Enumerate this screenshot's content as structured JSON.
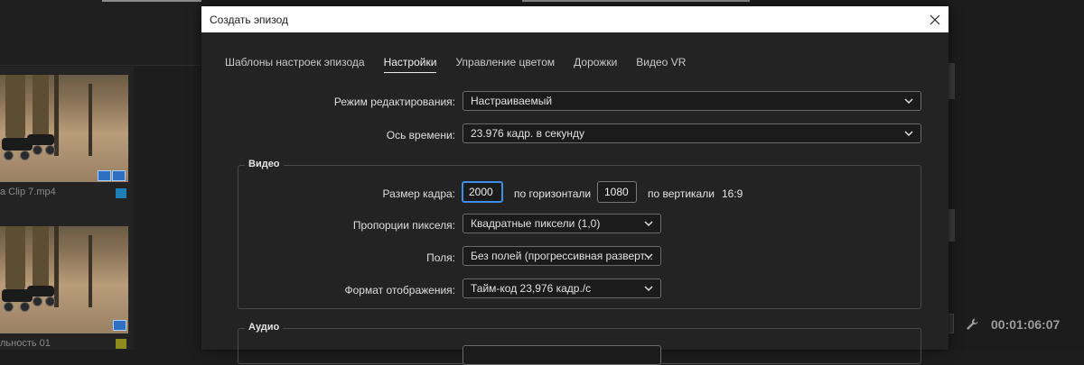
{
  "background": {
    "clips": [
      {
        "caption": "a Clip 7.mp4",
        "badge_color": "#1e7fb4"
      },
      {
        "caption": "льность 01",
        "badge_color": "#8d8b1e"
      }
    ],
    "timecode": "00:01:06:07"
  },
  "dialog": {
    "title": "Создать эпизод",
    "tabs": [
      {
        "label": "Шаблоны настроек эпизода",
        "active": false
      },
      {
        "label": "Настройки",
        "active": true
      },
      {
        "label": "Управление цветом",
        "active": false
      },
      {
        "label": "Дорожки",
        "active": false
      },
      {
        "label": "Видео VR",
        "active": false
      }
    ],
    "editing_mode": {
      "label": "Режим редактирования:",
      "value": "Настраиваемый"
    },
    "timebase": {
      "label": "Ось времени:",
      "value": "23.976  кадр. в секунду"
    },
    "video": {
      "title": "Видео",
      "frame_size": {
        "label": "Размер кадра:",
        "width": "2000",
        "horizontal_label": "по горизонтали",
        "height": "1080",
        "vertical_label": "по вертикали",
        "aspect": "16:9"
      },
      "pixel_aspect": {
        "label": "Пропорции пикселя:",
        "value": "Квадратные пиксели (1,0)"
      },
      "fields": {
        "label": "Поля:",
        "value": "Без полей (прогрессивная разверт..."
      },
      "display_format": {
        "label": "Формат отображения:",
        "value": "Тайм-код 23,976 кадр./с"
      }
    },
    "audio": {
      "title": "Аудио"
    }
  },
  "colors": {
    "accent_focus": "#3f8ee8",
    "dialog_bg": "#232323",
    "titlebar_bg": "#ffffff"
  }
}
